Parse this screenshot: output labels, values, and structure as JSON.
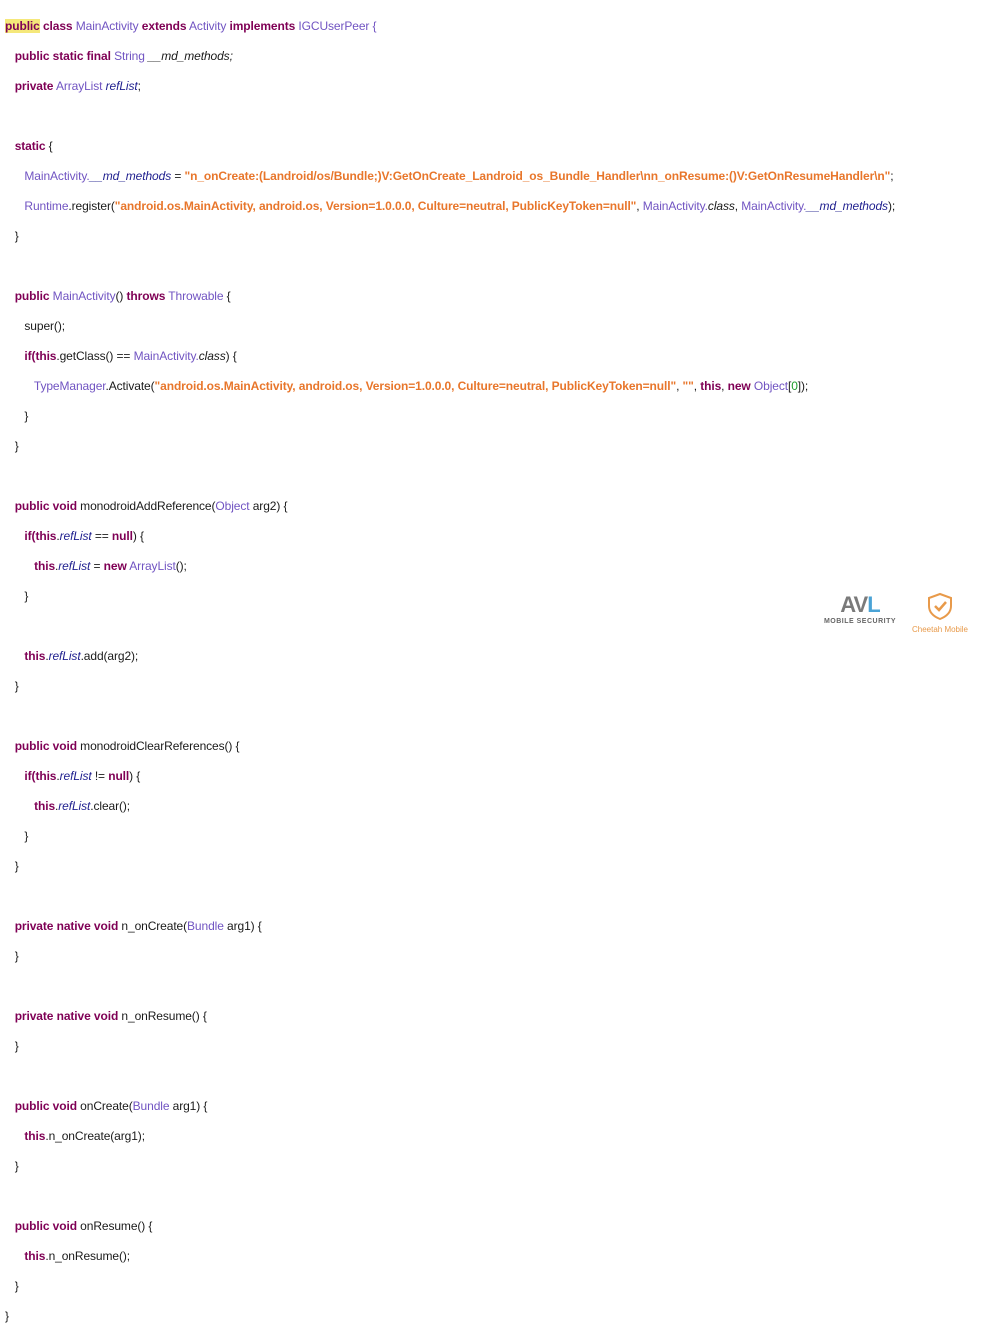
{
  "code": {
    "line01": [
      "public",
      " ",
      "class",
      " MainActivity ",
      "extends",
      " ",
      "Activity",
      " ",
      "implements",
      " IGCUserPeer {"
    ],
    "line02": [
      "public static final",
      " ",
      "String",
      " __md_methods;"
    ],
    "line03": [
      "private",
      " ",
      "ArrayList",
      " ",
      "refList",
      ";"
    ],
    "line05": [
      "static",
      " {"
    ],
    "line06": [
      "MainActivity.",
      "__md_methods",
      " = ",
      "\"n_onCreate:(Landroid/os/Bundle;)V:GetOnCreate_Landroid_os_Bundle_Handler\\nn_onResume:()V:GetOnResumeHandler\\n\"",
      ";"
    ],
    "line07": [
      "Runtime",
      ".register(",
      "\"android.os.MainActivity, android.os, Version=1.0.0.0, Culture=neutral, PublicKeyToken=null\"",
      ", ",
      "MainActivity.",
      "class",
      ", ",
      "MainActivity.",
      "__md_methods",
      ");"
    ],
    "line08": [
      "}"
    ],
    "line10": [
      "public",
      " ",
      "MainActivity",
      "() ",
      "throws",
      " ",
      "Throwable",
      " {"
    ],
    "line11": [
      "super();"
    ],
    "line12": [
      "if(",
      "this",
      ".getClass() == ",
      "MainActivity.",
      "class",
      ") {"
    ],
    "line13": [
      "TypeManager",
      ".Activate(",
      "\"android.os.MainActivity, android.os, Version=1.0.0.0, Culture=neutral, PublicKeyToken=null\"",
      ", ",
      "\"\"",
      ", ",
      "this",
      ", ",
      "new",
      " ",
      "Object",
      "[",
      "0",
      "]);"
    ],
    "line14": [
      "}"
    ],
    "line15": [
      "}"
    ],
    "line17": [
      "public void",
      " monodroidAddReference(",
      "Object",
      " arg2) {"
    ],
    "line18": [
      "if(",
      "this",
      ".",
      "refList",
      " == ",
      "null",
      ") {"
    ],
    "line19": [
      "this",
      ".",
      "refList",
      " = ",
      "new",
      " ",
      "ArrayList",
      "();"
    ],
    "line20": [
      "}"
    ],
    "line22": [
      "this",
      ".",
      "refList",
      ".add(arg2);"
    ],
    "line23": [
      "}"
    ],
    "line25": [
      "public void",
      " monodroidClearReferences() {"
    ],
    "line26": [
      "if(",
      "this",
      ".",
      "refList",
      " != ",
      "null",
      ") {"
    ],
    "line27": [
      "this",
      ".",
      "refList",
      ".clear();"
    ],
    "line28": [
      "}"
    ],
    "line29": [
      "}"
    ],
    "line31": [
      "private native void",
      " n_onCreate(",
      "Bundle",
      " arg1) {"
    ],
    "line32": [
      "}"
    ],
    "line34": [
      "private native void",
      " n_onResume() {"
    ],
    "line35": [
      "}"
    ],
    "line37": [
      "public void",
      " onCreate(",
      "Bundle",
      " arg1) {"
    ],
    "line38": [
      "this",
      ".n_onCreate(arg1);"
    ],
    "line39": [
      "}"
    ],
    "line41": [
      "public void",
      " onResume() {"
    ],
    "line42": [
      "this",
      ".n_onResume();"
    ],
    "line43": [
      "}"
    ],
    "line44": [
      "}"
    ]
  },
  "logos": {
    "avl_mark_a": "AV",
    "avl_mark_b": "L",
    "avl_text": "MOBILE SECURITY",
    "cheetah_text": "Cheetah Mobile",
    "colors": {
      "keyword": "#7f0055",
      "type": "#7154c2",
      "string": "#e8762b",
      "number": "#1f9c2d",
      "highlight": "#f5e87a"
    }
  }
}
